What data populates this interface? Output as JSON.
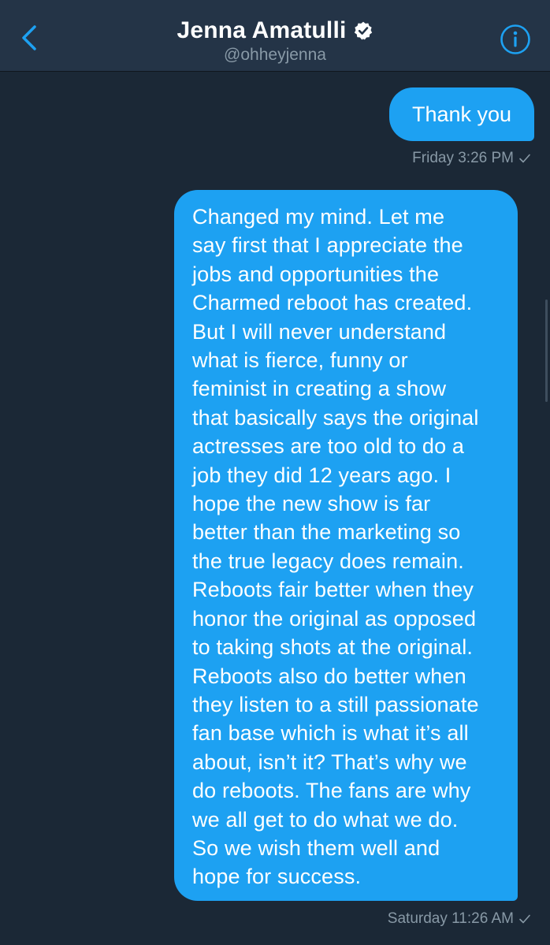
{
  "header": {
    "title": "Jenna Amatulli",
    "handle": "@ohheyjenna",
    "back_icon": "chevron-left-icon",
    "verified_icon": "verified-badge-icon",
    "info_icon": "info-icon"
  },
  "messages": [
    {
      "text": "Thank you",
      "timestamp": "Friday 3:26 PM"
    },
    {
      "text": "Changed my mind.  Let me\nsay first that I appreciate the\njobs and opportunities the\nCharmed reboot has created.\nBut I will never understand\nwhat is fierce, funny or\nfeminist in creating a show\nthat basically says the original\nactresses are too old to do a\njob they did 12 years ago. I\nhope the new show is far\nbetter than the marketing so\nthe true legacy does remain.\nReboots fair better when they\nhonor the original as opposed\nto taking shots at the original.\nReboots also do better when\nthey listen to a still passionate\nfan base which is what it’s all\nabout, isn’t it? That’s why we\ndo reboots. The fans are why\nwe all get to do what we do.\nSo we wish them well and\nhope for success.",
      "timestamp": "Saturday 11:26 AM"
    }
  ],
  "colors": {
    "background": "#1b2836",
    "header": "#243447",
    "accent": "#1da1f2",
    "muted": "#8899a6"
  }
}
